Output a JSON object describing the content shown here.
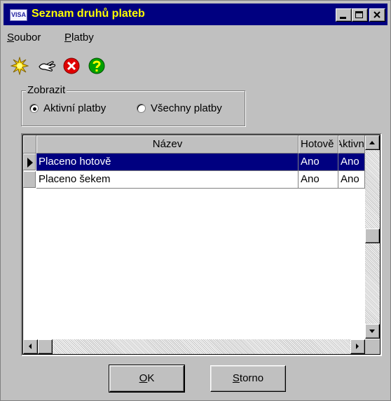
{
  "window": {
    "title": "Seznam druhů plateb",
    "app_icon_text": "VISA",
    "title_color": "#ffff00",
    "titlebar_color": "#000080"
  },
  "menu": {
    "items": [
      {
        "accel": "S",
        "rest": "oubor"
      },
      {
        "accel": "P",
        "rest": "latby"
      }
    ]
  },
  "toolbar": {
    "icons": [
      "new-item-icon",
      "edit-hand-icon",
      "delete-icon",
      "help-icon"
    ]
  },
  "filter": {
    "legend": "Zobrazit",
    "options": [
      {
        "label": "Aktivní platby",
        "checked": true
      },
      {
        "label": "Všechny platby",
        "checked": false
      }
    ]
  },
  "grid": {
    "columns": [
      "Název",
      "Hotově",
      "Aktivní"
    ],
    "rows": [
      {
        "nazev": "Placeno hotově",
        "hotove": "Ano",
        "aktivni": "Ano",
        "selected": true
      },
      {
        "nazev": "Placeno šekem",
        "hotove": "Ano",
        "aktivni": "Ano",
        "selected": false
      }
    ],
    "selection_color": "#000080"
  },
  "buttons": {
    "ok": {
      "accel": "O",
      "rest": "K"
    },
    "cancel": {
      "pre": "",
      "accel": "S",
      "rest": "torno"
    }
  }
}
